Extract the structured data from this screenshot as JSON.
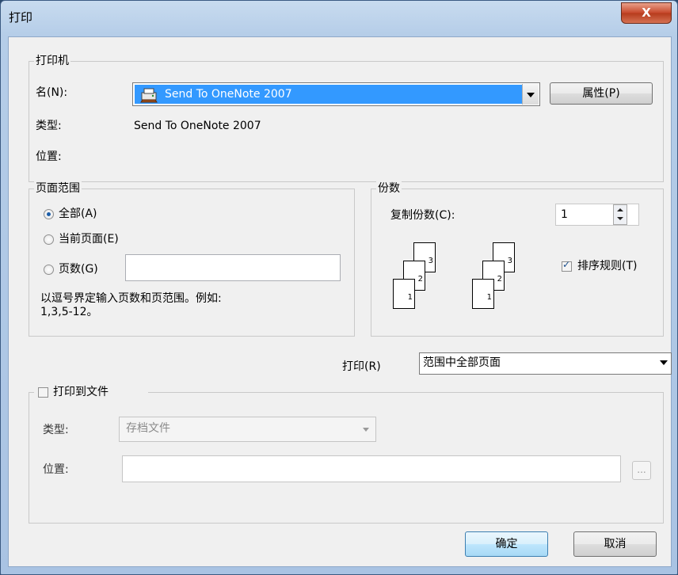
{
  "window": {
    "title": "打印",
    "close_label": "X"
  },
  "printer": {
    "legend": "打印机",
    "name_label": "名(N):",
    "name_value": "Send To OneNote 2007",
    "properties_button": "属性(P)",
    "type_label": "类型:",
    "type_value": "Send To OneNote 2007",
    "location_label": "位置:"
  },
  "page_range": {
    "legend": "页面范围",
    "options": [
      "全部(A)",
      "当前页面(E)",
      "页数(G)"
    ],
    "selected": "全部(A)",
    "pages_value": "",
    "hint_line1": "以逗号界定输入页数和页范围。例如:",
    "hint_line2": "1,3,5-12。"
  },
  "copies": {
    "legend": "份数",
    "count_label": "复制份数(C):",
    "count_value": "1",
    "collate_label": "排序规则(T)",
    "collate_checked": true,
    "page_numbers": [
      "1",
      "2",
      "3"
    ]
  },
  "print_what": {
    "label": "打印(R)",
    "value": "范围中全部页面"
  },
  "print_to_file": {
    "label": "打印到文件",
    "checked": false,
    "type_label": "类型:",
    "type_value": "存档文件",
    "location_label": "位置:",
    "location_value": "",
    "browse_label": "..."
  },
  "buttons": {
    "ok": "确定",
    "cancel": "取消"
  }
}
